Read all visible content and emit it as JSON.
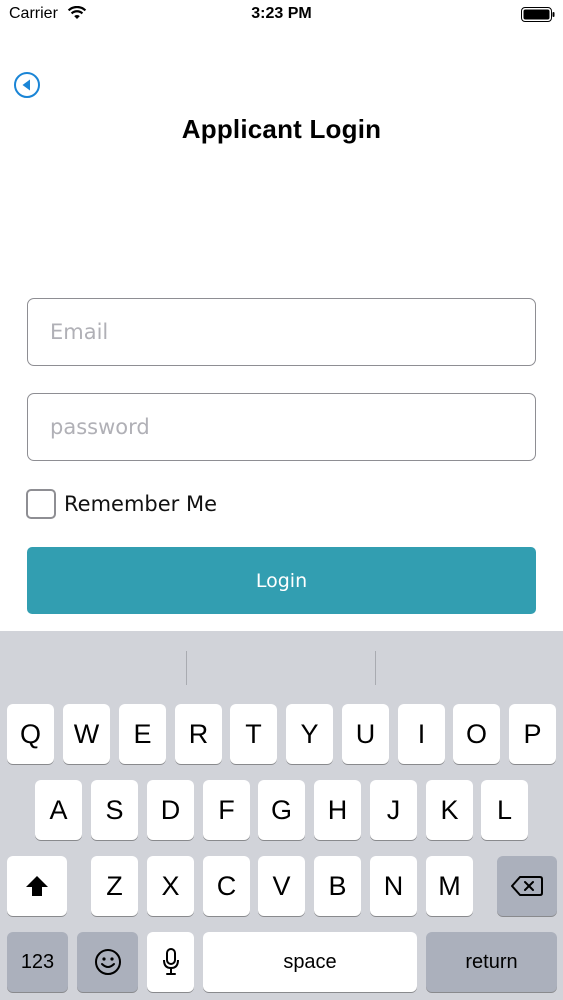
{
  "status_bar": {
    "carrier": "Carrier",
    "time": "3:23 PM"
  },
  "header": {
    "title": "Applicant Login"
  },
  "form": {
    "email_placeholder": "Email",
    "password_placeholder": "password",
    "remember_label": "Remember Me",
    "remember_checked": false,
    "login_label": "Login"
  },
  "keyboard": {
    "row1": [
      "Q",
      "W",
      "E",
      "R",
      "T",
      "Y",
      "U",
      "I",
      "O",
      "P"
    ],
    "row2": [
      "A",
      "S",
      "D",
      "F",
      "G",
      "H",
      "J",
      "K",
      "L"
    ],
    "row3": [
      "Z",
      "X",
      "C",
      "V",
      "B",
      "N",
      "M"
    ],
    "numbers_label": "123",
    "space_label": "space",
    "return_label": "return",
    "icons": {
      "shift": "shift-icon",
      "delete": "delete-icon",
      "emoji": "emoji-icon",
      "mic": "microphone-icon"
    }
  },
  "colors": {
    "accent": "#329eb1",
    "back_icon": "#1a85d6",
    "keyboard_bg": "#d1d3d9"
  }
}
